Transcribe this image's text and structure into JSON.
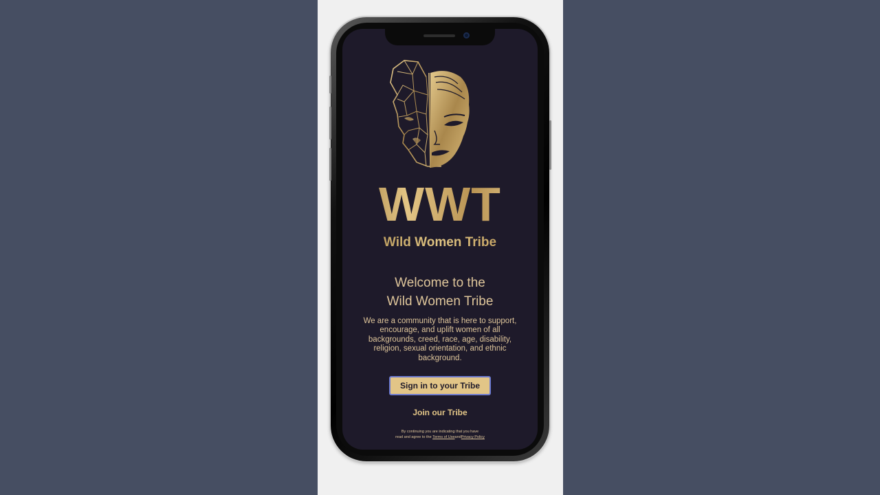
{
  "brand": {
    "acronym": "WWT",
    "name": "Wild Women Tribe"
  },
  "welcome": {
    "line1": "Welcome to the",
    "line2": "Wild Women Tribe"
  },
  "description": "We are a community that is here to support, encourage, and uplift women of all backgrounds, creed, race, age, disability, religion, sexual orientation, and ethnic background.",
  "actions": {
    "sign_in_label": "Sign in to your Tribe",
    "join_label": "Join our Tribe"
  },
  "legal": {
    "line1": "By continuing you are indicating that you have",
    "line2_prefix": "read and agree to the",
    "terms_label": "Terms of Use",
    "and": "and",
    "privacy_label": "Privacy Policy"
  },
  "colors": {
    "page_background": "#464e62",
    "screen_background": "#1e1a2a",
    "gold": "#dec59a",
    "button_fill": "#e2c587"
  },
  "icons": {
    "logo": "wolf-woman-face-logo"
  }
}
